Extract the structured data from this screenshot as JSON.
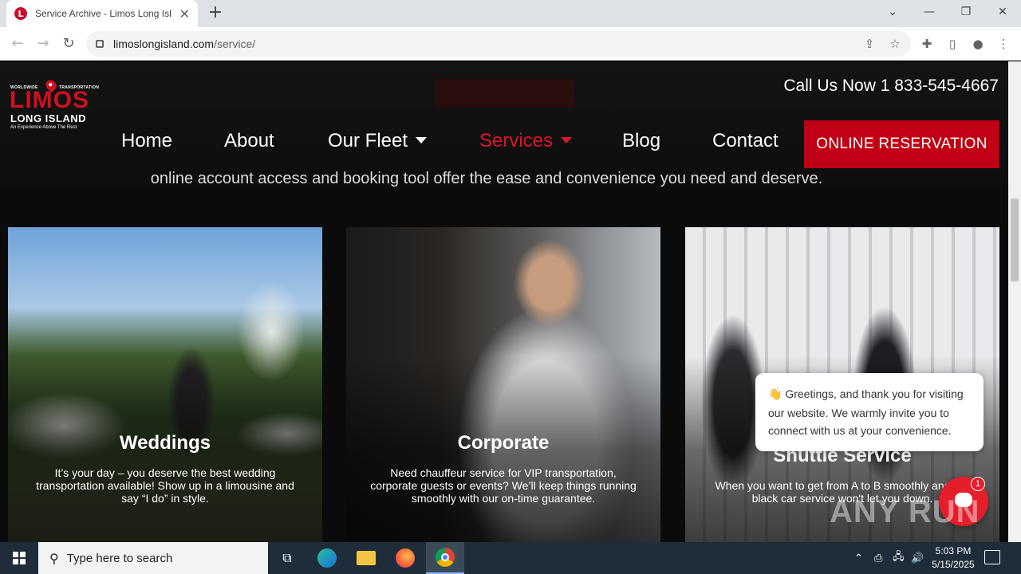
{
  "browser": {
    "tab_title": "Service Archive - Limos Long Isl",
    "tab_close": "✕",
    "new_tab": "+",
    "url_domain": "limoslongisland.com",
    "url_path": "/service/",
    "win_min": "—",
    "win_restore": "❐",
    "win_close": "✕",
    "tab_list": "⌄"
  },
  "site": {
    "logo_top_left": "WORLDWIDE",
    "logo_top_right": "TRANSPORTATION",
    "logo_main": "LIMOS",
    "logo_sub": "LONG ISLAND",
    "logo_tagline": "An Experience Above The Rest",
    "call_us": "Call Us Now 1 833-545-4667",
    "nav": {
      "home": "Home",
      "about": "About",
      "fleet": "Our Fleet",
      "services": "Services",
      "blog": "Blog",
      "contact": "Contact",
      "reserve": "ONLINE RESERVATION"
    },
    "intro_line": "online account access and booking tool offer the ease and convenience you need and deserve."
  },
  "cards": [
    {
      "title": "Weddings",
      "desc": "It’s your day – you deserve the best wedding transportation available! Show up in a limousine and say “I do” in style."
    },
    {
      "title": "Corporate",
      "desc": "Need chauffeur service for VIP transportation, corporate guests or events? We’ll keep things running smoothly with our on-time guarantee."
    },
    {
      "title": "Shuttle Service",
      "desc": "When you want to get from A to B smoothly and our black car service won't let you down."
    }
  ],
  "chat": {
    "wave": "👋",
    "message": "Greetings, and thank you for visiting our website. We warmly invite you to connect with us at your convenience.",
    "badge": "1"
  },
  "watermark": "ANY RUN",
  "taskbar": {
    "search_placeholder": "Type here to search",
    "time": "5:03 PM",
    "date": "5/15/2025"
  },
  "colors": {
    "accent_red": "#c00014",
    "nav_active": "#e0152a"
  }
}
